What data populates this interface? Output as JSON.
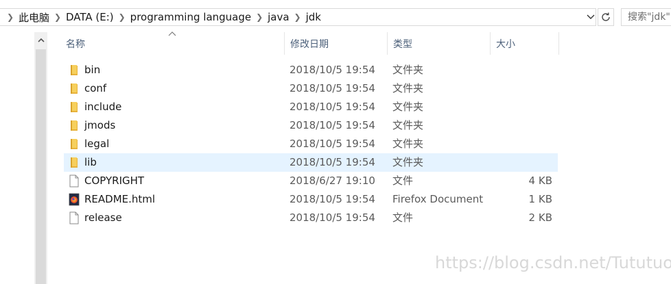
{
  "address_bar": {
    "breadcrumbs": [
      "此电脑",
      "DATA (E:)",
      "programming language",
      "java",
      "jdk"
    ],
    "search_placeholder": "搜索\"jdk\""
  },
  "columns": {
    "name": "名称",
    "date_modified": "修改日期",
    "type": "类型",
    "size": "大小"
  },
  "files": [
    {
      "name": "bin",
      "date": "2018/10/5 19:54",
      "type": "文件夹",
      "size": "",
      "icon": "folder-icon"
    },
    {
      "name": "conf",
      "date": "2018/10/5 19:54",
      "type": "文件夹",
      "size": "",
      "icon": "folder-icon"
    },
    {
      "name": "include",
      "date": "2018/10/5 19:54",
      "type": "文件夹",
      "size": "",
      "icon": "folder-icon"
    },
    {
      "name": "jmods",
      "date": "2018/10/5 19:54",
      "type": "文件夹",
      "size": "",
      "icon": "folder-icon"
    },
    {
      "name": "legal",
      "date": "2018/10/5 19:54",
      "type": "文件夹",
      "size": "",
      "icon": "folder-icon"
    },
    {
      "name": "lib",
      "date": "2018/10/5 19:54",
      "type": "文件夹",
      "size": "",
      "icon": "folder-icon",
      "selected": true
    },
    {
      "name": "COPYRIGHT",
      "date": "2018/6/27 19:10",
      "type": "文件",
      "size": "4 KB",
      "icon": "file-icon"
    },
    {
      "name": "README.html",
      "date": "2018/10/5 19:54",
      "type": "Firefox Document",
      "size": "1 KB",
      "icon": "firefox-document-icon"
    },
    {
      "name": "release",
      "date": "2018/10/5 19:54",
      "type": "文件",
      "size": "2 KB",
      "icon": "file-icon"
    }
  ],
  "colors": {
    "selected_row": "#e5f3ff",
    "header_text": "#4c607a",
    "folder": "#f3c64d"
  },
  "watermark": "https://blog.csdn.net/Tututuo"
}
